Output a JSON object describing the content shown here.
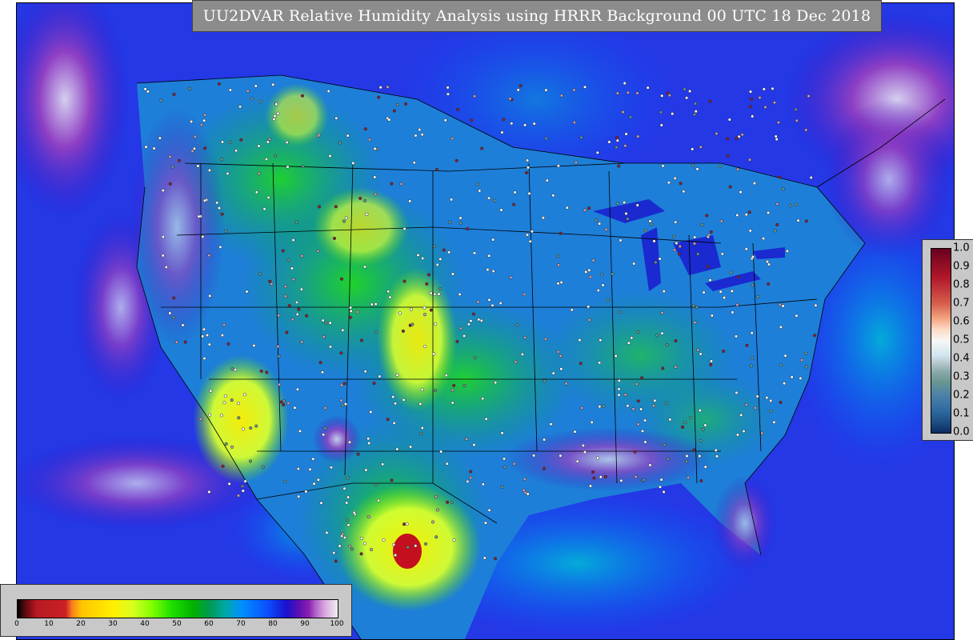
{
  "title": "UU2DVAR Relative Humidity Analysis using HRRR Background 00 UTC 18 Dec 2018",
  "rh_colorbar": {
    "ticks": [
      "0",
      "10",
      "20",
      "30",
      "40",
      "50",
      "60",
      "70",
      "80",
      "90",
      "100"
    ]
  },
  "increment_colorbar": {
    "ticks": [
      "1.0",
      "0.9",
      "0.8",
      "0.7",
      "0.6",
      "0.5",
      "0.4",
      "0.3",
      "0.2",
      "0.1",
      "0.0"
    ]
  },
  "colors": {
    "ocean": "#2a3fe0",
    "dry": "#fff000",
    "moist": "#00b000",
    "saturated": "#7a20b0",
    "state_lines": "#000000",
    "station_markers": "#ffffff"
  }
}
